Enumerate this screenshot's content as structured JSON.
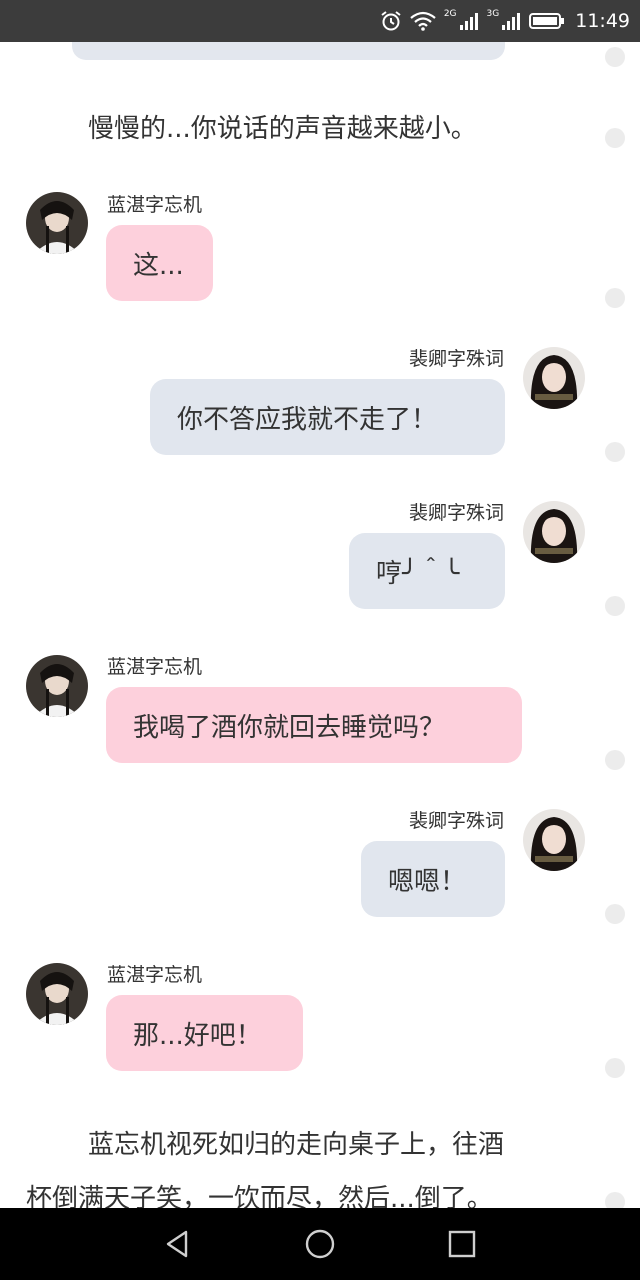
{
  "status_bar": {
    "time": "11:49",
    "network_2g": "2G",
    "network_3g": "3G",
    "icons": [
      "alarm-icon",
      "wifi-icon",
      "signal-icon",
      "signal-icon",
      "battery-icon"
    ]
  },
  "narration": {
    "line1": "慢慢的...你说话的声音越来越小。",
    "line2a": "蓝忘机视死如归的走向桌子上，往酒",
    "line2b": "杯倒满天子笑，一饮而尽，然后...倒了。"
  },
  "messages": [
    {
      "sender": "蓝湛字忘机",
      "text": "这..."
    },
    {
      "sender": "裴卿字殊词",
      "text": "你不答应我就不走了！"
    },
    {
      "sender": "裴卿字殊词",
      "text": "哼╯＾╰"
    },
    {
      "sender": "蓝湛字忘机",
      "text": "我喝了酒你就回去睡觉吗？"
    },
    {
      "sender": "裴卿字殊词",
      "text": "嗯嗯！"
    },
    {
      "sender": "蓝湛字忘机",
      "text": "那...好吧！"
    }
  ],
  "colors": {
    "left_bubble": "#fdd0dc",
    "right_bubble": "#e1e6ee",
    "status_bar": "#3c3c3c",
    "nav_bar": "#000000"
  },
  "nav": {
    "icons": [
      "back-icon",
      "home-icon",
      "recents-icon"
    ]
  }
}
